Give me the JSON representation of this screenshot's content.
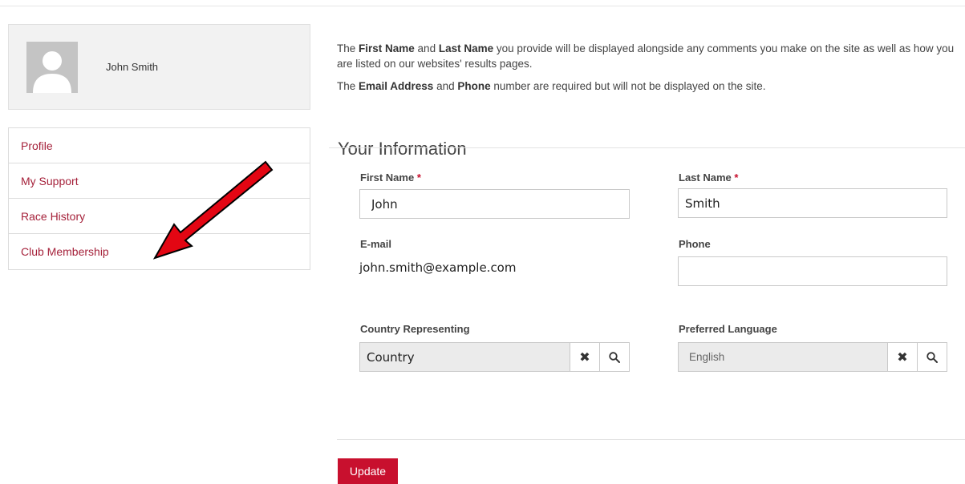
{
  "profile": {
    "name": "John Smith"
  },
  "sidebar": {
    "items": [
      {
        "label": "Profile"
      },
      {
        "label": "My Support"
      },
      {
        "label": "Race History"
      },
      {
        "label": "Club Membership"
      }
    ]
  },
  "intro": {
    "p1_prefix": "The ",
    "p1_bold1": "First Name",
    "p1_mid": " and ",
    "p1_bold2": "Last Name",
    "p1_suffix": " you provide will be displayed alongside any comments you make on the site as well as how you are listed on our websites' results pages.",
    "p2_prefix": "The ",
    "p2_bold1": "Email Address",
    "p2_mid": " and ",
    "p2_bold2": "Phone",
    "p2_suffix": " number are required but will not be displayed on the site."
  },
  "form": {
    "section_title": "Your Information",
    "first_name": {
      "label": "First Name",
      "required_mark": "*",
      "value": "John"
    },
    "last_name": {
      "label": "Last Name",
      "required_mark": "*",
      "value": "Smith"
    },
    "email": {
      "label": "E-mail",
      "value": "john.smith@example.com"
    },
    "phone": {
      "label": "Phone",
      "value": ""
    },
    "country": {
      "label": "Country Representing",
      "value": "Country"
    },
    "language": {
      "label": "Preferred Language",
      "value": "English"
    },
    "update_label": "Update"
  },
  "icons": {
    "clear": "close-icon",
    "search": "search-icon",
    "avatar": "user-silhouette-icon",
    "annotation": "red-arrow-icon"
  },
  "colors": {
    "accent": "#c8102e",
    "link": "#a5213a",
    "arrow": "#e30613"
  }
}
